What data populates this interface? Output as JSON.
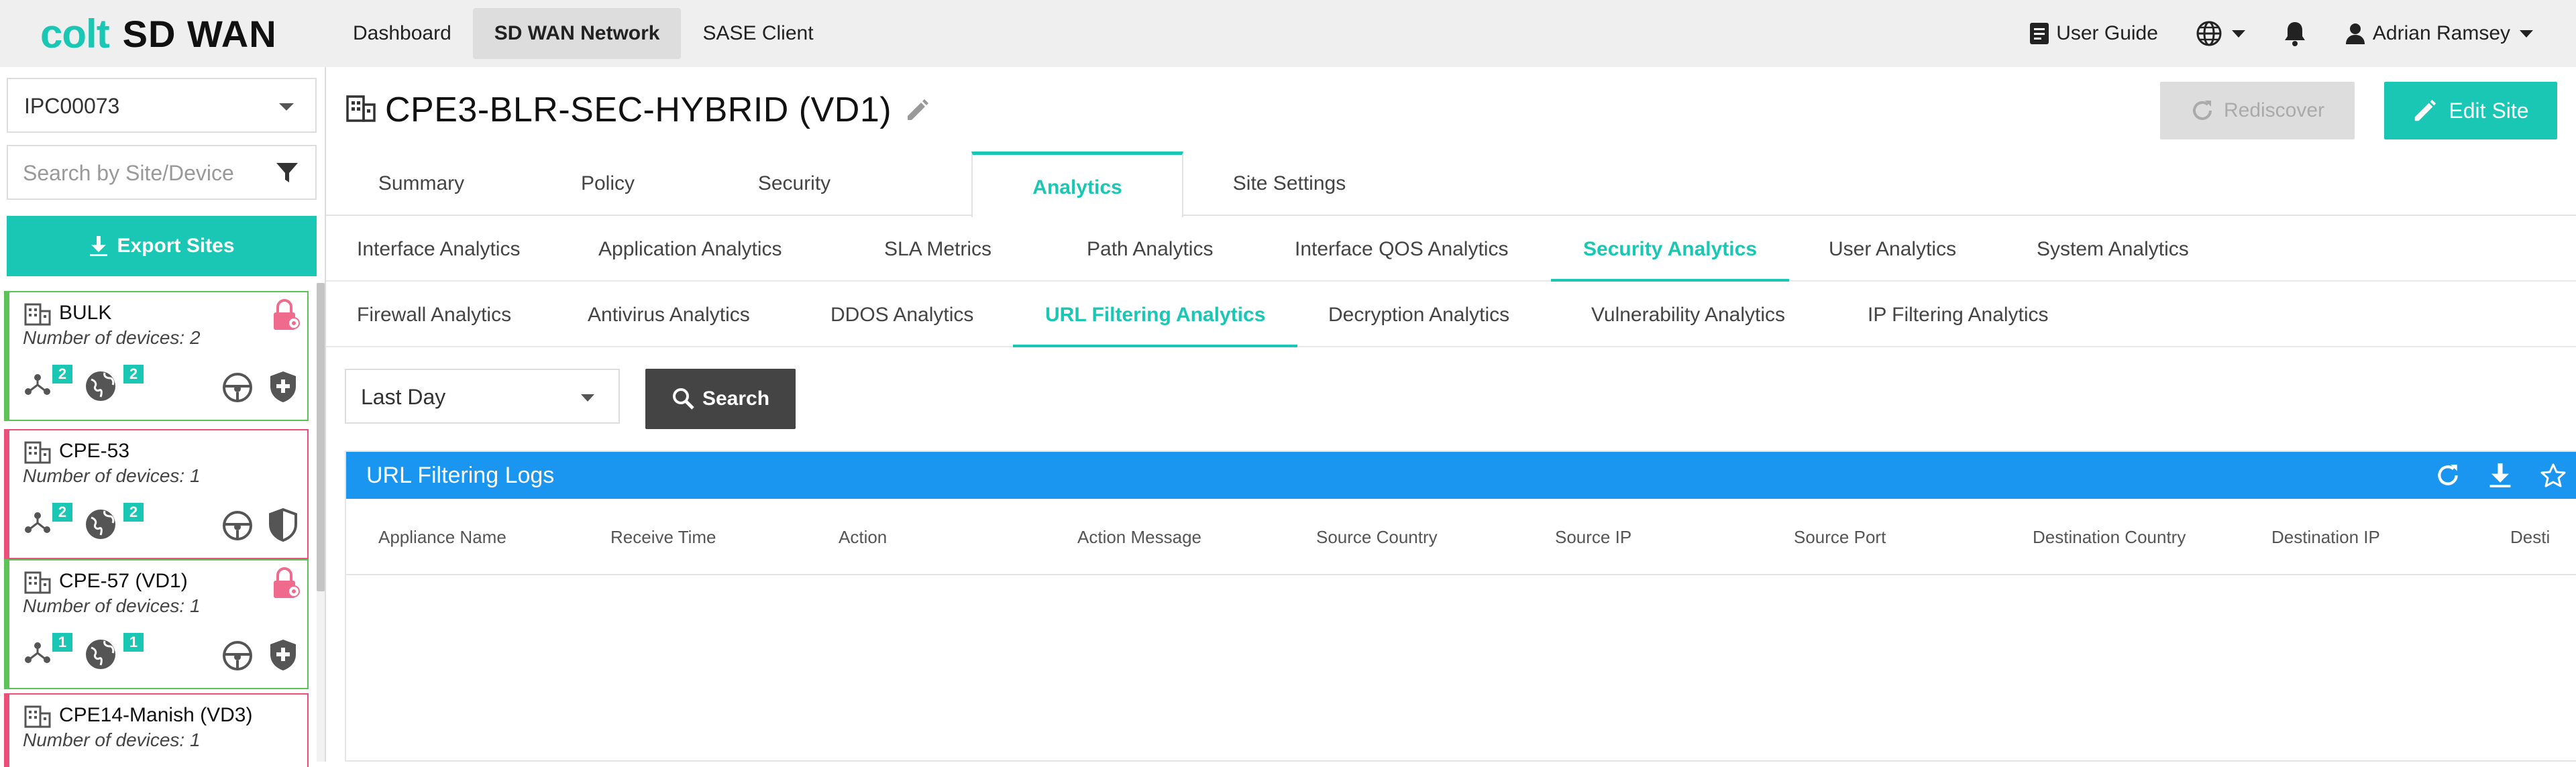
{
  "brand": {
    "logo_word": "colt",
    "product": "SD WAN",
    "accent": "#1ac7b4",
    "header_blue": "#1a96f0"
  },
  "topnav": {
    "items": [
      {
        "label": "Dashboard"
      },
      {
        "label": "SD WAN Network"
      },
      {
        "label": "SASE Client"
      }
    ],
    "active_item": "SD WAN Network",
    "user_guide": "User Guide",
    "language_icon": "globe-icon",
    "notifications_icon": "bell-icon",
    "user_name": "Adrian Ramsey"
  },
  "sidebar": {
    "tenant_value": "IPC00073",
    "search_placeholder": "Search by Site/Device",
    "export_label": "Export Sites",
    "sites": [
      {
        "name": "BULK",
        "devices": "Number of devices: 2",
        "topology_count": "2",
        "internet_count": "2",
        "status_color": "#5cc456",
        "locked": true,
        "security": "shield-plus-icon"
      },
      {
        "name": "CPE-53",
        "devices": "Number of devices: 1",
        "topology_count": "2",
        "internet_count": "2",
        "status_color": "#ec4e7a",
        "locked": false,
        "security": "shield-half-icon"
      },
      {
        "name": "CPE-57 (VD1)",
        "devices": "Number of devices: 1",
        "topology_count": "1",
        "internet_count": "1",
        "status_color": "#5cc456",
        "locked": true,
        "security": "shield-plus-icon"
      },
      {
        "name": "CPE14-Manish (VD3)",
        "devices": "Number of devices: 1",
        "status_color": "#ec4e7a"
      }
    ]
  },
  "site": {
    "title": "CPE3-BLR-SEC-HYBRID (VD1)",
    "rediscover_label": "Rediscover",
    "edit_label": "Edit Site"
  },
  "tabs": {
    "main": [
      {
        "label": "Summary"
      },
      {
        "label": "Policy"
      },
      {
        "label": "Security"
      },
      {
        "label": "Analytics"
      },
      {
        "label": "Site Settings"
      }
    ],
    "main_active": "Analytics",
    "analytics": [
      {
        "label": "Interface Analytics"
      },
      {
        "label": "Application Analytics"
      },
      {
        "label": "SLA Metrics"
      },
      {
        "label": "Path Analytics"
      },
      {
        "label": "Interface QOS Analytics"
      },
      {
        "label": "Security Analytics"
      },
      {
        "label": "User Analytics"
      },
      {
        "label": "System Analytics"
      }
    ],
    "analytics_active": "Security Analytics",
    "security": [
      {
        "label": "Firewall Analytics"
      },
      {
        "label": "Antivirus Analytics"
      },
      {
        "label": "DDOS Analytics"
      },
      {
        "label": "URL Filtering Analytics"
      },
      {
        "label": "Decryption Analytics"
      },
      {
        "label": "Vulnerability Analytics"
      },
      {
        "label": "IP Filtering Analytics"
      }
    ],
    "security_active": "URL Filtering Analytics"
  },
  "filters": {
    "period": "Last Day",
    "search_label": "Search"
  },
  "logs": {
    "title": "URL Filtering Logs",
    "header_icons": [
      "refresh-icon",
      "download-icon",
      "star-icon"
    ],
    "columns": [
      "Appliance Name",
      "Receive Time",
      "Action",
      "Action Message",
      "Source Country",
      "Source IP",
      "Source Port",
      "Destination Country",
      "Destination IP",
      "Desti"
    ],
    "rows": []
  }
}
